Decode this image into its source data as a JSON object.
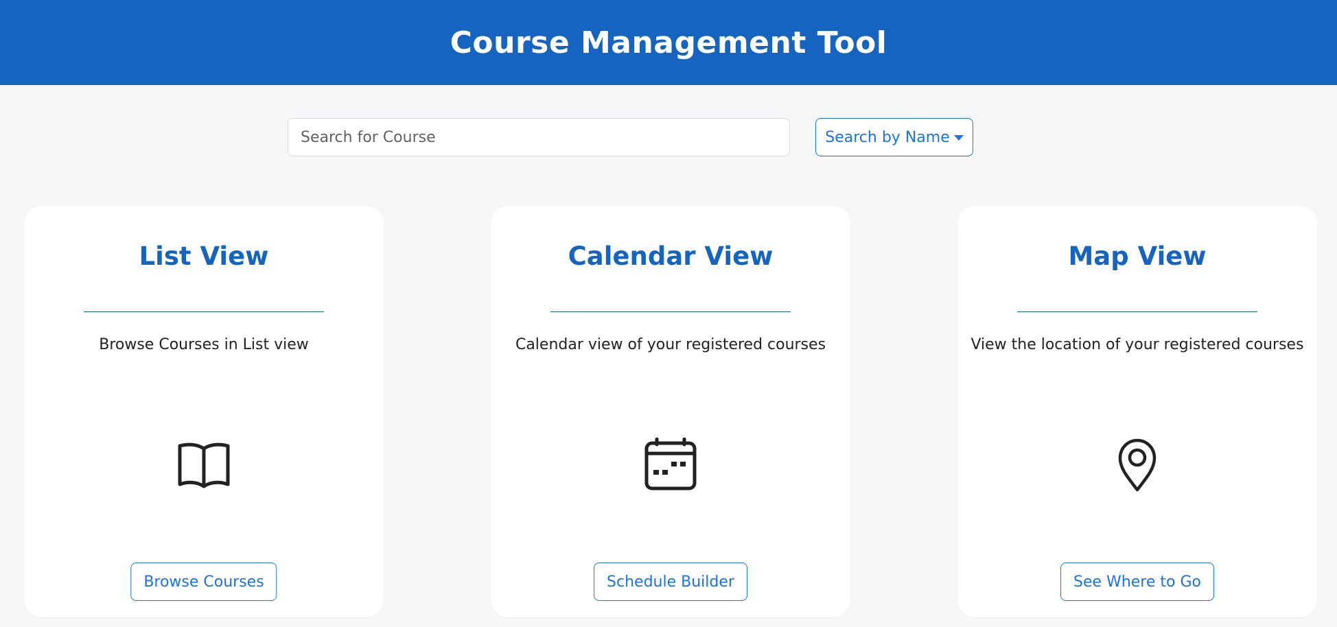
{
  "header": {
    "title": "Course Management Tool"
  },
  "search": {
    "placeholder": "Search for Course",
    "mode_label": "Search by Name"
  },
  "cards": [
    {
      "title": "List View",
      "description": "Browse Courses in List view",
      "icon": "book-icon",
      "button_label": "Browse Courses"
    },
    {
      "title": "Calendar View",
      "description": "Calendar view of your registered courses",
      "icon": "calendar-icon",
      "button_label": "Schedule Builder"
    },
    {
      "title": "Map View",
      "description": "View the location of your registered courses",
      "icon": "map-pin-icon",
      "button_label": "See Where to Go"
    }
  ],
  "colors": {
    "header_bg": "#1565c0",
    "accent": "#1a73e8",
    "page_bg": "#f6f7f9"
  }
}
